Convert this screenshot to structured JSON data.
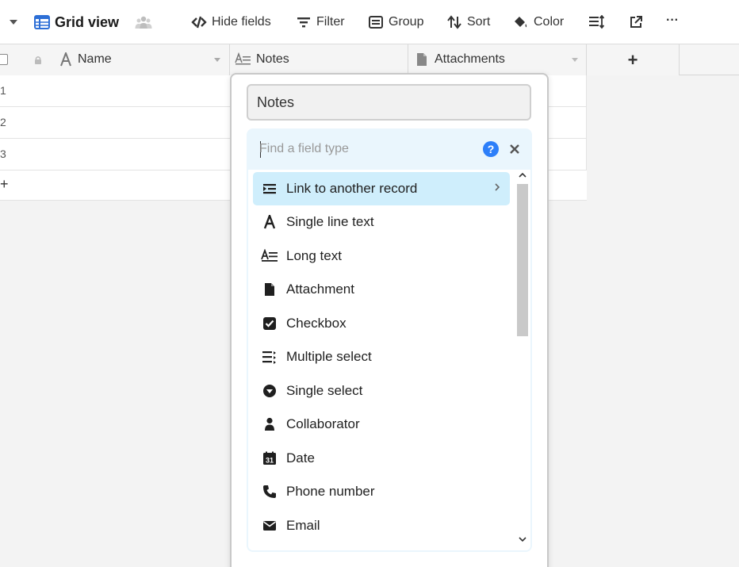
{
  "toolbar": {
    "view_name": "Grid view",
    "hide_fields": "Hide fields",
    "filter": "Filter",
    "group": "Group",
    "sort": "Sort",
    "color": "Color",
    "more": "···"
  },
  "grid": {
    "columns": [
      "Name",
      "Notes",
      "Attachments"
    ],
    "add_column": "+",
    "rows": [
      "1",
      "2",
      "3"
    ],
    "add_row": "+"
  },
  "field_editor": {
    "field_name": "Notes",
    "search_placeholder": "Find a field type",
    "help": "?",
    "field_types": [
      {
        "label": "Link to another record",
        "icon": "link-records-icon"
      },
      {
        "label": "Single line text",
        "icon": "text-a-icon"
      },
      {
        "label": "Long text",
        "icon": "long-text-icon"
      },
      {
        "label": "Attachment",
        "icon": "file-icon"
      },
      {
        "label": "Checkbox",
        "icon": "checkbox-icon"
      },
      {
        "label": "Multiple select",
        "icon": "multi-select-icon"
      },
      {
        "label": "Single select",
        "icon": "single-select-icon"
      },
      {
        "label": "Collaborator",
        "icon": "person-icon"
      },
      {
        "label": "Date",
        "icon": "calendar-icon"
      },
      {
        "label": "Phone number",
        "icon": "phone-icon"
      },
      {
        "label": "Email",
        "icon": "envelope-icon"
      }
    ],
    "date_icon_text": "31"
  },
  "colors": {
    "accent_blue": "#2d7ff9",
    "grid_icon_blue": "#2d6fd6",
    "highlight": "#cfeefc",
    "panel_bg": "#eaf6fd"
  }
}
